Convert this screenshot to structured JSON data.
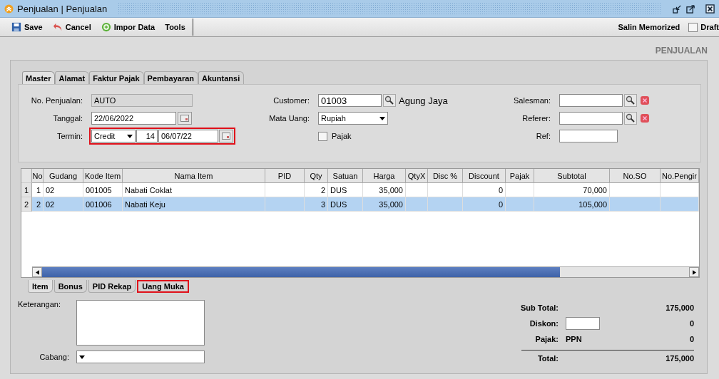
{
  "window": {
    "title": "Penjualan | Penjualan"
  },
  "toolbar": {
    "buttons": [
      {
        "label": "Save"
      },
      {
        "label": "Cancel"
      },
      {
        "label": "Impor Data"
      },
      {
        "label": "Tools"
      }
    ],
    "copy_label": "Salin Memorized",
    "draft": {
      "label": "Draft",
      "checked": false
    }
  },
  "heading": "PENJUALAN",
  "tabs": [
    {
      "label": "Master",
      "selected": true
    },
    {
      "label": "Alamat",
      "selected": false
    },
    {
      "label": "Faktur Pajak",
      "selected": false
    },
    {
      "label": "Pembayaran",
      "selected": false
    },
    {
      "label": "Akuntansi",
      "selected": false
    }
  ],
  "master": {
    "no_penjualan": {
      "label": "No. Penjualan:",
      "value": "AUTO",
      "disabled": true
    },
    "tanggal": {
      "label": "Tanggal:",
      "value": "22/06/2022"
    },
    "termin": {
      "label": "Termin:",
      "type": "Credit",
      "days": "14",
      "due_date": "06/07/22",
      "highlighted": true
    },
    "customer": {
      "label": "Customer:",
      "code": "01003",
      "name": "Agung Jaya"
    },
    "mata_uang": {
      "label": "Mata Uang:",
      "value": "Rupiah"
    },
    "pajak": {
      "label": "Pajak",
      "checked": false
    },
    "salesman": {
      "label": "Salesman:"
    },
    "referer": {
      "label": "Referer:"
    },
    "ref": {
      "label": "Ref:"
    }
  },
  "table": {
    "columns": [
      "No",
      "Gudang",
      "Kode Item",
      "Nama Item",
      "PID",
      "Qty",
      "Satuan",
      "Harga",
      "QtyX",
      "Disc %",
      "Discount",
      "Pajak",
      "Subtotal",
      "No.SO",
      "No.Pengir"
    ],
    "rows": [
      {
        "number": "1",
        "selected": false,
        "cells": [
          "1",
          "02",
          "001005",
          "Nabati Coklat",
          null,
          "2",
          "DUS",
          "35,000",
          null,
          null,
          "0",
          null,
          "70,000",
          null,
          null
        ]
      },
      {
        "number": "2",
        "selected": true,
        "cells": [
          "2",
          "02",
          "001006",
          "Nabati Keju",
          null,
          "3",
          "DUS",
          "35,000",
          null,
          null,
          "0",
          null,
          "105,000",
          null,
          null
        ]
      }
    ]
  },
  "bottom_tabs": [
    {
      "label": "Item",
      "selected": true,
      "highlighted": false
    },
    {
      "label": "Bonus",
      "selected": false,
      "highlighted": false
    },
    {
      "label": "PID Rekap",
      "selected": false,
      "highlighted": false
    },
    {
      "label": "Uang Muka",
      "selected": false,
      "highlighted": true
    }
  ],
  "notes": {
    "label": "Keterangan:"
  },
  "branch": {
    "label": "Cabang:"
  },
  "totals": {
    "subtotal": {
      "label": "Sub Total:",
      "value": "175,000"
    },
    "discount": {
      "label": "Diskon:",
      "value": "0"
    },
    "tax": {
      "label": "Pajak:",
      "type": "PPN",
      "value": "0"
    },
    "total": {
      "label": "Total:",
      "value": "175,000"
    }
  }
}
